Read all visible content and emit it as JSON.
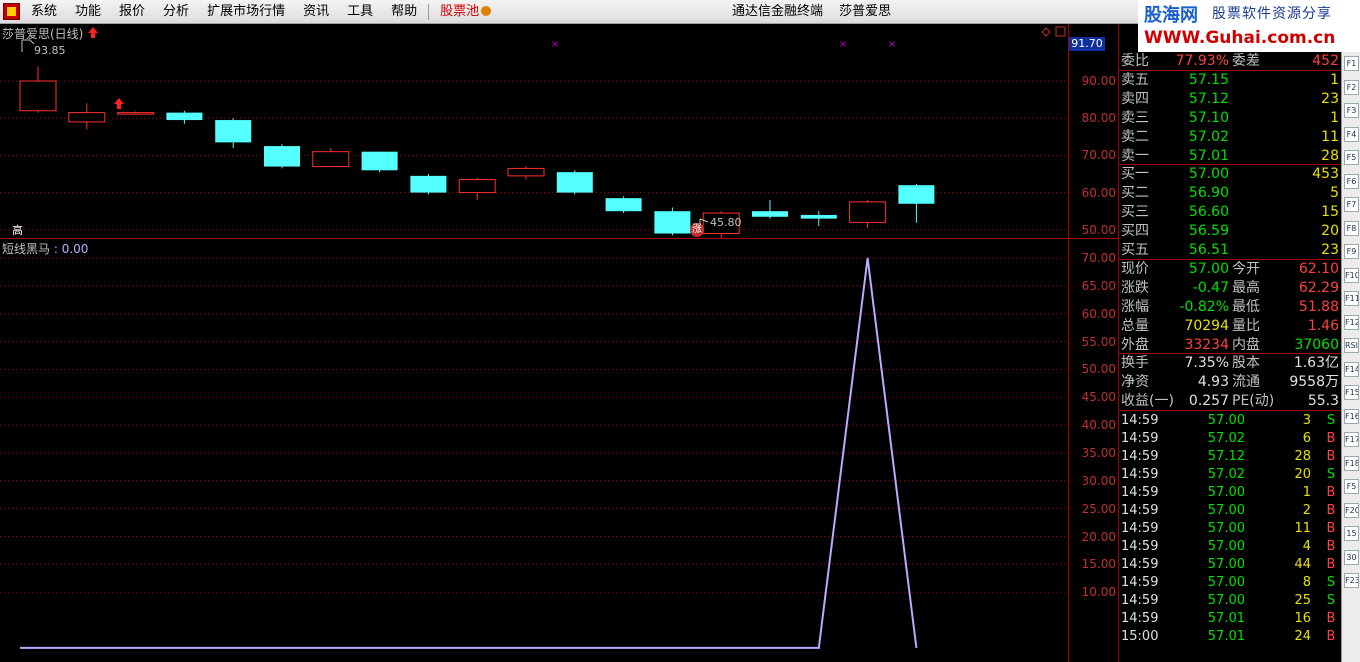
{
  "menu": {
    "items": [
      "系统",
      "功能",
      "报价",
      "分析",
      "扩展市场行情",
      "资讯",
      "工具",
      "帮助"
    ],
    "highlight": "股票池",
    "center": [
      "通达信金融终端",
      "莎普爱思"
    ],
    "brand": "股海网",
    "brand_slogan": "股票软件资源分享",
    "brand_url": "WWW.Guhai.com.cn"
  },
  "main_chart": {
    "title": "莎普爱思(日线)",
    "high_label": "93.85",
    "low_label": "45.80",
    "gao_label": "高",
    "zhang_label": "涨",
    "current_tag": "91.70",
    "y_ticks": [
      "90.00",
      "80.00",
      "70.00",
      "60.00",
      "50.00"
    ],
    "candles": [
      {
        "open": 82,
        "close": 90,
        "high": 93.85,
        "low": 81.5
      },
      {
        "open": 79,
        "close": 81.5,
        "high": 84,
        "low": 77
      },
      {
        "open": 81.5,
        "close": 81.5,
        "high": 81.8,
        "low": 81
      },
      {
        "open": 81.5,
        "close": 79.5,
        "high": 82,
        "low": 78.5
      },
      {
        "open": 79.5,
        "close": 73.5,
        "high": 80,
        "low": 72
      },
      {
        "open": 72.5,
        "close": 67,
        "high": 73,
        "low": 66.5
      },
      {
        "open": 67,
        "close": 71,
        "high": 72,
        "low": 67
      },
      {
        "open": 71,
        "close": 66,
        "high": 71,
        "low": 65.5
      },
      {
        "open": 64.5,
        "close": 60,
        "high": 65,
        "low": 59.5
      },
      {
        "open": 60,
        "close": 63.5,
        "high": 64,
        "low": 58
      },
      {
        "open": 64.5,
        "close": 66.5,
        "high": 67,
        "low": 63.5
      },
      {
        "open": 65.5,
        "close": 60,
        "high": 66,
        "low": 59.5
      },
      {
        "open": 58.5,
        "close": 55,
        "high": 59,
        "low": 54.5
      },
      {
        "open": 55,
        "close": 49,
        "high": 56,
        "low": 48.5
      },
      {
        "open": 49,
        "close": 54.5,
        "high": 55,
        "low": 45.8
      },
      {
        "open": 55,
        "close": 53.5,
        "high": 58,
        "low": 53
      },
      {
        "open": 54,
        "close": 53,
        "high": 55,
        "low": 51
      },
      {
        "open": 52,
        "close": 57.5,
        "high": 58,
        "low": 50.5
      },
      {
        "open": 62,
        "close": 57,
        "high": 62.3,
        "low": 51.9
      }
    ]
  },
  "indicator": {
    "title": "短线黑马",
    "value_label": ": 0.00",
    "y_ticks": [
      "70.00",
      "65.00",
      "60.00",
      "55.00",
      "50.00",
      "45.00",
      "40.00",
      "35.00",
      "30.00",
      "25.00",
      "20.00",
      "15.00",
      "10.00"
    ],
    "values": [
      0,
      0,
      0,
      0,
      0,
      0,
      0,
      0,
      0,
      0,
      0,
      0,
      0,
      0,
      0,
      0,
      0,
      70,
      0
    ]
  },
  "quote": {
    "weibi": {
      "label": "委比",
      "value": "77.93%",
      "label2": "委差",
      "value2": "452"
    },
    "asks": [
      {
        "label": "卖五",
        "price": "57.15",
        "vol": "1"
      },
      {
        "label": "卖四",
        "price": "57.12",
        "vol": "23"
      },
      {
        "label": "卖三",
        "price": "57.10",
        "vol": "1"
      },
      {
        "label": "卖二",
        "price": "57.02",
        "vol": "11"
      },
      {
        "label": "卖一",
        "price": "57.01",
        "vol": "28"
      }
    ],
    "bids": [
      {
        "label": "买一",
        "price": "57.00",
        "vol": "453"
      },
      {
        "label": "买二",
        "price": "56.90",
        "vol": "5"
      },
      {
        "label": "买三",
        "price": "56.60",
        "vol": "15"
      },
      {
        "label": "买四",
        "price": "56.59",
        "vol": "20"
      },
      {
        "label": "买五",
        "price": "56.51",
        "vol": "23"
      }
    ],
    "stats1": [
      {
        "l": "现价",
        "v": "57.00",
        "l2": "今开",
        "v2": "62.10"
      },
      {
        "l": "涨跌",
        "v": "-0.47",
        "l2": "最高",
        "v2": "62.29"
      },
      {
        "l": "涨幅",
        "v": "-0.82%",
        "l2": "最低",
        "v2": "51.88"
      },
      {
        "l": "总量",
        "v": "70294",
        "l2": "量比",
        "v2": "1.46"
      },
      {
        "l": "外盘",
        "v": "33234",
        "l2": "内盘",
        "v2": "37060"
      }
    ],
    "stats2": [
      {
        "l": "换手",
        "v": "7.35%",
        "l2": "股本",
        "v2": "1.63亿"
      },
      {
        "l": "净资",
        "v": "4.93",
        "l2": "流通",
        "v2": "9558万"
      },
      {
        "l": "收益(一)",
        "v": "0.257",
        "l2": "PE(动)",
        "v2": "55.3"
      }
    ],
    "ticks": [
      {
        "t": "14:59",
        "p": "57.00",
        "q": "3",
        "f": "S"
      },
      {
        "t": "14:59",
        "p": "57.02",
        "q": "6",
        "f": "B"
      },
      {
        "t": "14:59",
        "p": "57.12",
        "q": "28",
        "f": "B"
      },
      {
        "t": "14:59",
        "p": "57.02",
        "q": "20",
        "f": "S"
      },
      {
        "t": "14:59",
        "p": "57.00",
        "q": "1",
        "f": "B"
      },
      {
        "t": "14:59",
        "p": "57.00",
        "q": "2",
        "f": "B"
      },
      {
        "t": "14:59",
        "p": "57.00",
        "q": "11",
        "f": "B"
      },
      {
        "t": "14:59",
        "p": "57.00",
        "q": "4",
        "f": "B"
      },
      {
        "t": "14:59",
        "p": "57.00",
        "q": "44",
        "f": "B"
      },
      {
        "t": "14:59",
        "p": "57.00",
        "q": "8",
        "f": "S"
      },
      {
        "t": "14:59",
        "p": "57.00",
        "q": "25",
        "f": "S"
      },
      {
        "t": "14:59",
        "p": "57.01",
        "q": "16",
        "f": "B"
      },
      {
        "t": "15:00",
        "p": "57.01",
        "q": "24",
        "f": "B"
      }
    ]
  },
  "sidebar": [
    "F1",
    "F2",
    "F3",
    "F4",
    "F5",
    "F6",
    "F7",
    "F8",
    "F9",
    "F10",
    "F11",
    "F12",
    "RSI",
    "F14",
    "F15",
    "F16",
    "F17",
    "F18",
    "F5",
    "F20",
    "15",
    "30",
    "F23"
  ],
  "colors": {
    "up": "#ff3030",
    "down": "#54ffff",
    "indicator": "#c0a8ff",
    "grid": "#a00000"
  }
}
